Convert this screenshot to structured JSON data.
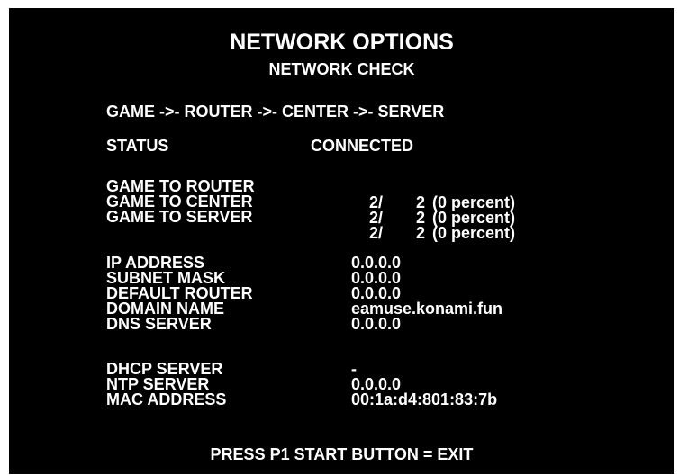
{
  "screen": {
    "title": "NETWORK OPTIONS",
    "subtitle": "NETWORK CHECK",
    "route": "GAME ->- ROUTER ->- CENTER ->- SERVER",
    "status": {
      "label": "STATUS",
      "value": "CONNECTED"
    },
    "checks": [
      {
        "label": "GAME TO ROUTER",
        "ok": "2/",
        "total": "2",
        "percent": "(0 percent)"
      },
      {
        "label": "GAME TO CENTER",
        "ok": "2/",
        "total": "2",
        "percent": "(0 percent)"
      },
      {
        "label": "GAME TO SERVER",
        "ok": "2/",
        "total": "2",
        "percent": "(0 percent)"
      }
    ],
    "network": [
      {
        "label": "IP ADDRESS",
        "value": "0.0.0.0"
      },
      {
        "label": "SUBNET MASK",
        "value": "0.0.0.0"
      },
      {
        "label": "DEFAULT ROUTER",
        "value": "0.0.0.0"
      },
      {
        "label": "DOMAIN NAME",
        "value": "eamuse.konami.fun"
      },
      {
        "label": "DNS SERVER",
        "value": "0.0.0.0"
      }
    ],
    "services": [
      {
        "label": "DHCP SERVER",
        "value": "-"
      },
      {
        "label": "NTP SERVER",
        "value": "0.0.0.0"
      },
      {
        "label": "MAC ADDRESS",
        "value": "00:1a:d4:801:83:7b"
      }
    ],
    "footer": "PRESS P1 START BUTTON = EXIT"
  }
}
